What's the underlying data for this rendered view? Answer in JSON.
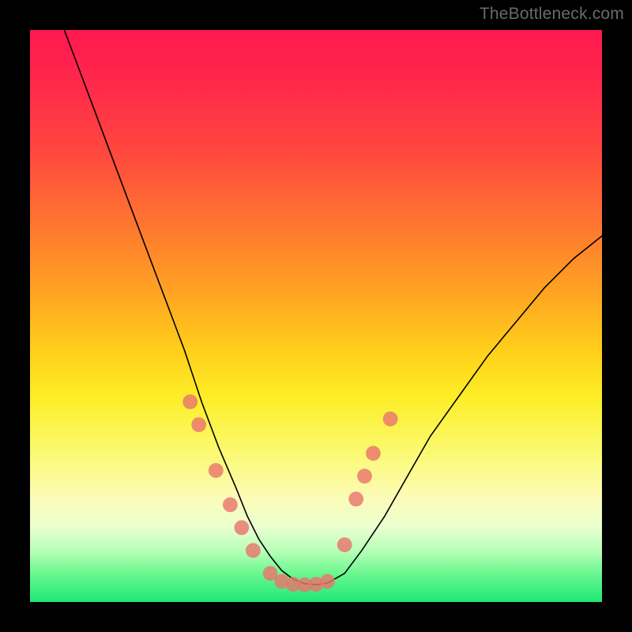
{
  "watermark": "TheBottleneck.com",
  "chart_data": {
    "type": "line",
    "title": "",
    "xlabel": "",
    "ylabel": "",
    "xlim": [
      0,
      100
    ],
    "ylim": [
      0,
      100
    ],
    "note": "x and y are percent of plot width/height; y=0 is bottom (green), y=100 is top (red). Curve is a V-shaped bottleneck trace; markers are highlighted points along the curve.",
    "series": [
      {
        "name": "bottleneck-curve",
        "x": [
          6,
          9,
          12,
          15,
          18,
          21,
          24,
          27,
          30,
          33,
          36,
          38,
          40,
          42,
          44,
          46,
          48,
          50,
          52,
          55,
          58,
          62,
          66,
          70,
          75,
          80,
          85,
          90,
          95,
          100
        ],
        "y": [
          100,
          92,
          84,
          76,
          68,
          60,
          52,
          44,
          35,
          27,
          20,
          15,
          11,
          8,
          5.5,
          4,
          3.2,
          3,
          3.3,
          5,
          9,
          15,
          22,
          29,
          36,
          43,
          49,
          55,
          60,
          64
        ]
      }
    ],
    "markers": [
      {
        "x": 28,
        "y": 35
      },
      {
        "x": 29.5,
        "y": 31
      },
      {
        "x": 32.5,
        "y": 23
      },
      {
        "x": 35,
        "y": 17
      },
      {
        "x": 37,
        "y": 13
      },
      {
        "x": 39,
        "y": 9
      },
      {
        "x": 42,
        "y": 5
      },
      {
        "x": 44,
        "y": 3.6
      },
      {
        "x": 46,
        "y": 3.1
      },
      {
        "x": 48,
        "y": 3
      },
      {
        "x": 50,
        "y": 3.1
      },
      {
        "x": 52,
        "y": 3.6
      },
      {
        "x": 55,
        "y": 10
      },
      {
        "x": 57,
        "y": 18
      },
      {
        "x": 58.5,
        "y": 22
      },
      {
        "x": 60,
        "y": 26
      },
      {
        "x": 63,
        "y": 32
      }
    ],
    "marker_radius_percent": 1.3
  }
}
